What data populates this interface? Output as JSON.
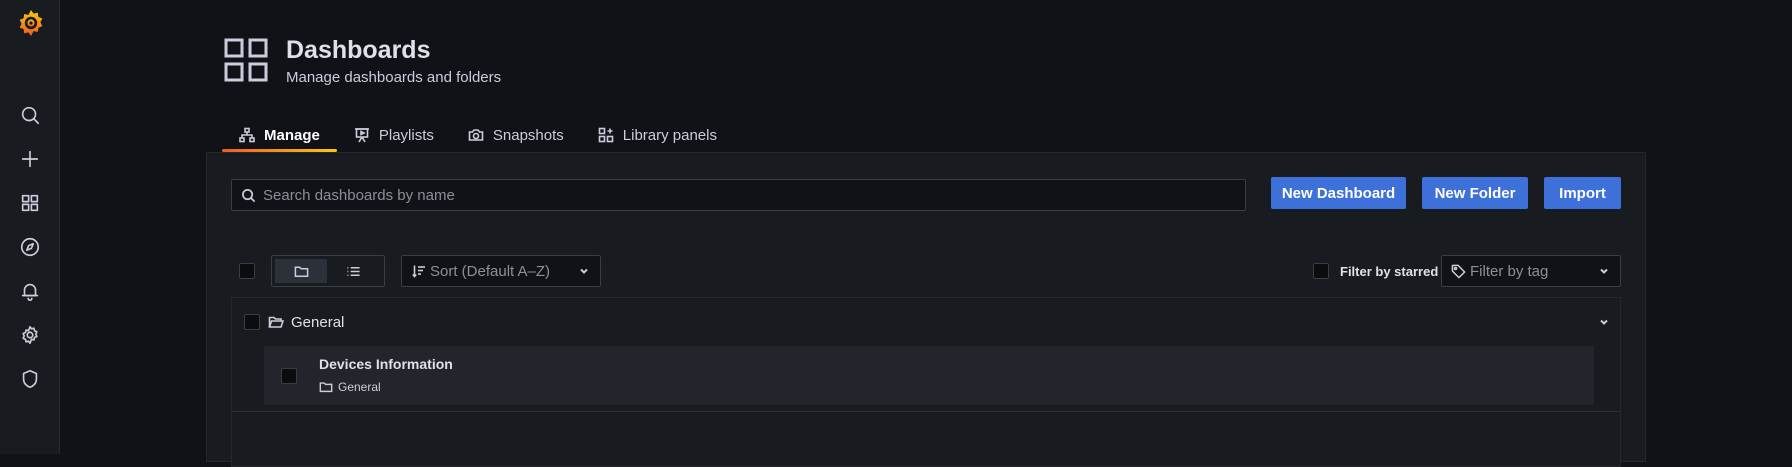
{
  "sidebar": {
    "logo": "grafana-logo",
    "icons": [
      "search-icon",
      "plus-icon",
      "dashboards-icon",
      "explore-compass-icon",
      "alerting-bell-icon",
      "configuration-gear-icon",
      "server-admin-shield-icon"
    ]
  },
  "header": {
    "title": "Dashboards",
    "subtitle": "Manage dashboards and folders"
  },
  "tabs": [
    {
      "label": "Manage",
      "icon": "sitemap-icon",
      "active": true
    },
    {
      "label": "Playlists",
      "icon": "presentation-play-icon",
      "active": false
    },
    {
      "label": "Snapshots",
      "icon": "camera-icon",
      "active": false
    },
    {
      "label": "Library panels",
      "icon": "library-panel-icon",
      "active": false
    }
  ],
  "search": {
    "placeholder": "Search dashboards by name"
  },
  "actions": {
    "new_dashboard": "New Dashboard",
    "new_folder": "New Folder",
    "import": "Import"
  },
  "toolbar": {
    "view_modes": [
      "folder-view",
      "list-view"
    ],
    "active_view": "folder-view",
    "sort_placeholder": "Sort (Default A–Z)",
    "filter_starred_label": "Filter by starred",
    "filter_tag_placeholder": "Filter by tag"
  },
  "folders": [
    {
      "name": "General",
      "expanded": true,
      "items": [
        {
          "title": "Devices Information",
          "folder": "General"
        }
      ]
    }
  ],
  "colors": {
    "background": "#111217",
    "panel": "#181b1f",
    "primary_button": "#3d71d9",
    "tab_underline_start": "#f05a28",
    "tab_underline_end": "#fbca0a"
  }
}
